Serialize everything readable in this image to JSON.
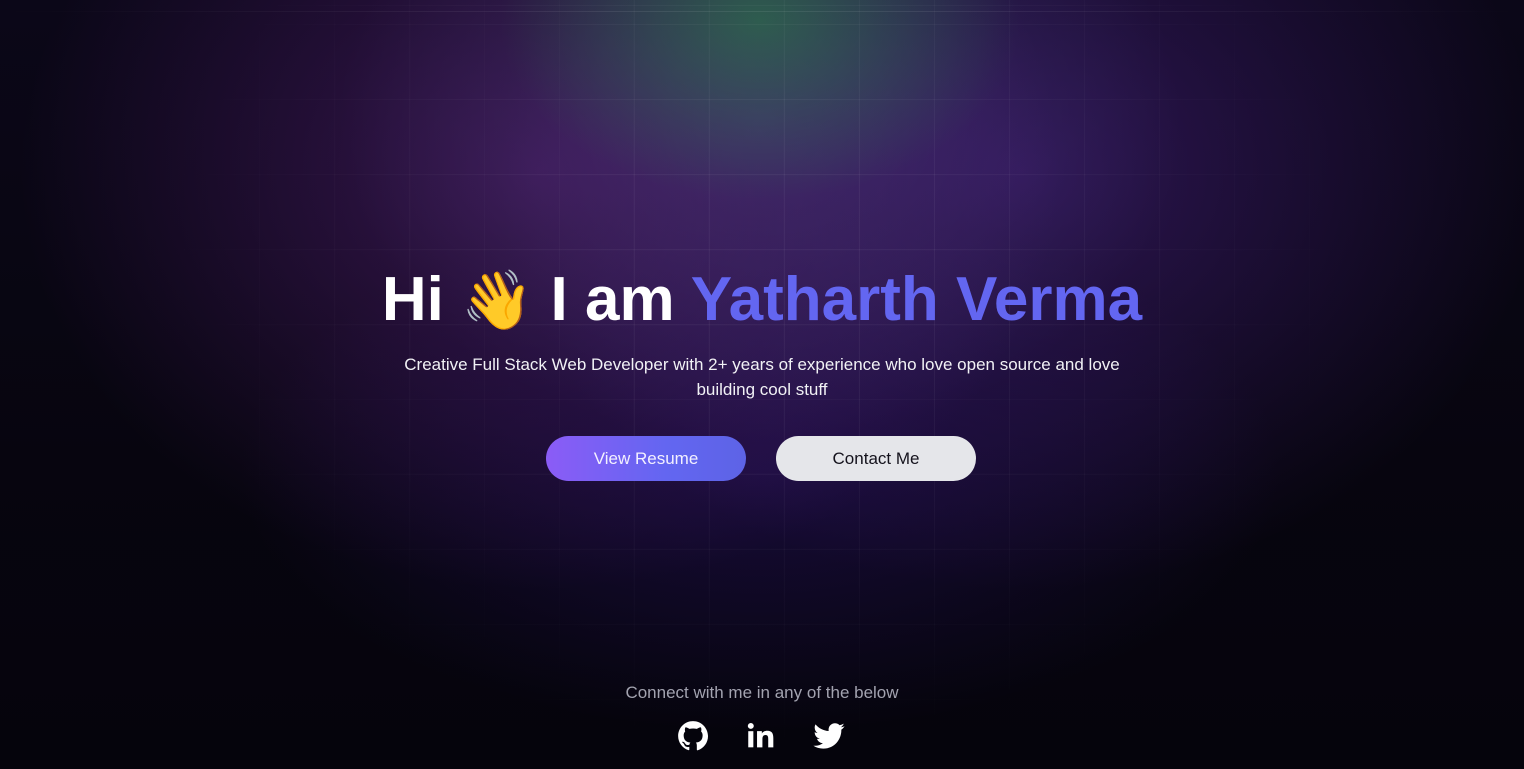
{
  "hero": {
    "greeting": "Hi",
    "wave_emoji": "👋",
    "intro": "I am",
    "name": "Yatharth Verma",
    "subtitle": "Creative Full Stack Web Developer with 2+ years of experience who love open source and love building cool stuff"
  },
  "buttons": {
    "resume_label": "View Resume",
    "contact_label": "Contact Me"
  },
  "footer": {
    "connect_text": "Connect with me in any of the below",
    "socials": [
      {
        "icon": "github-icon",
        "label": "GitHub"
      },
      {
        "icon": "linkedin-icon",
        "label": "LinkedIn"
      },
      {
        "icon": "twitter-icon",
        "label": "Twitter"
      }
    ]
  },
  "colors": {
    "accent": "#6366f1",
    "button_gradient_start": "#8b5cf6",
    "button_gradient_end": "#6366f1",
    "secondary_button": "#e5e6ea",
    "background": "#07040f",
    "muted_text": "#a3a3b0"
  }
}
